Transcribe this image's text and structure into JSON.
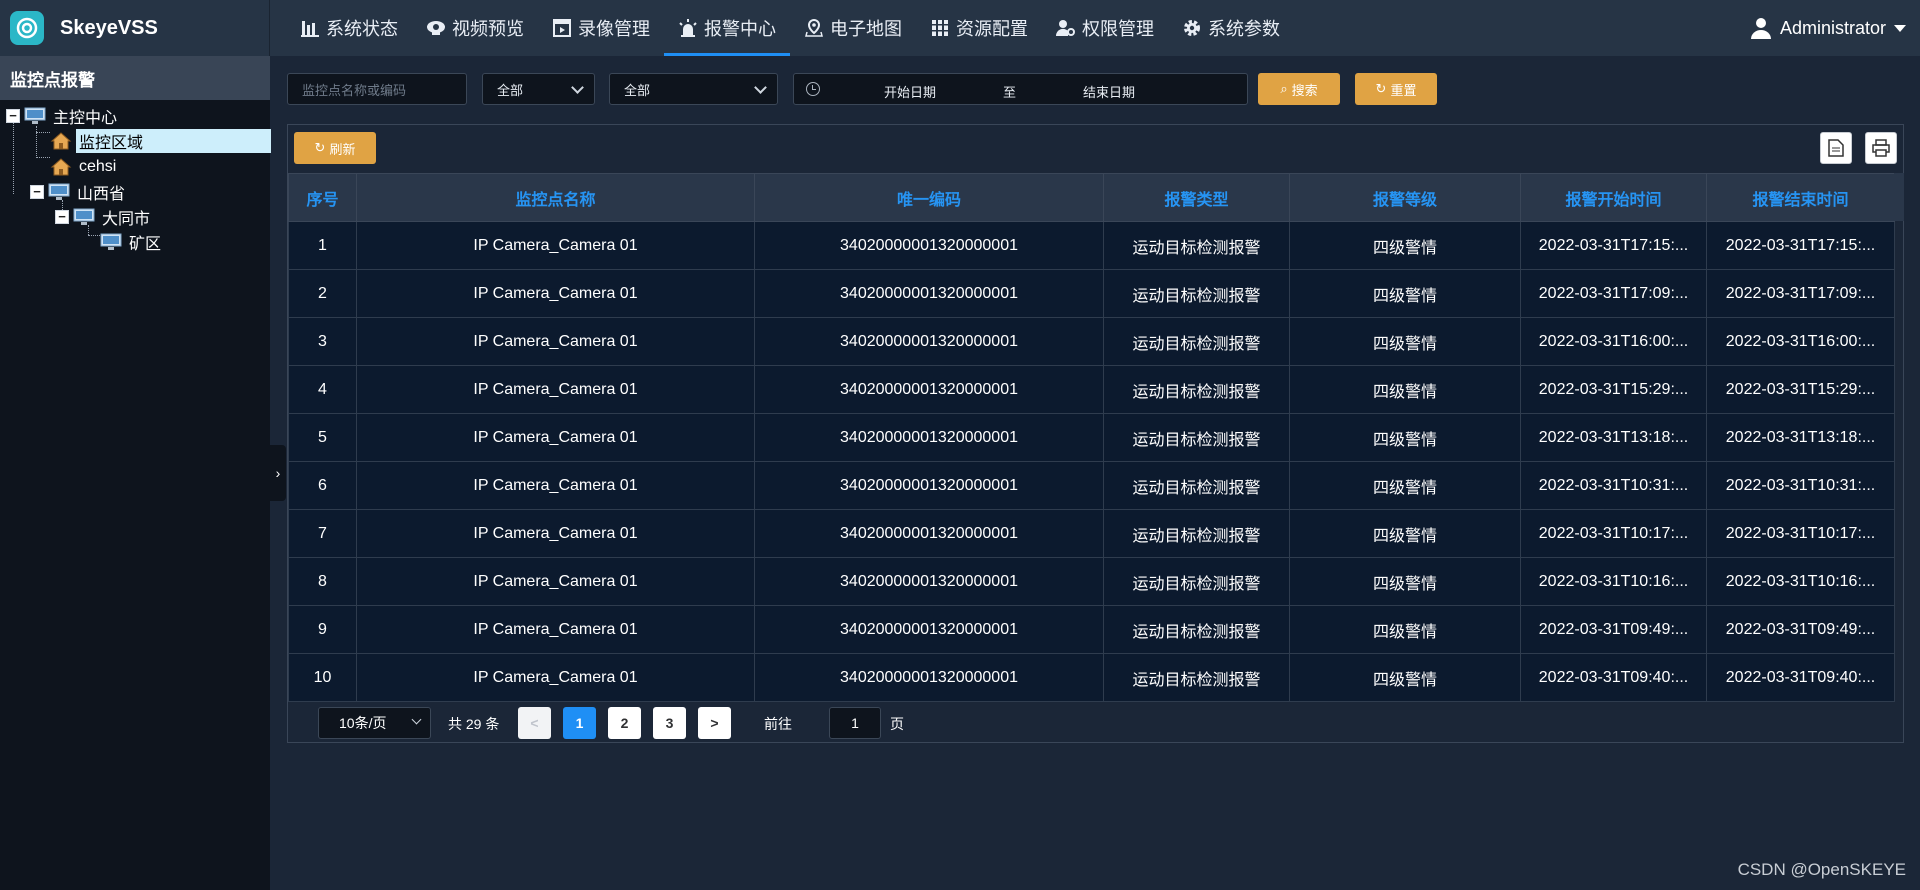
{
  "app": {
    "name": "SkeyeVSS"
  },
  "nav": [
    {
      "label": "系统状态",
      "icon": "bar-chart-icon"
    },
    {
      "label": "视频预览",
      "icon": "camera-icon"
    },
    {
      "label": "录像管理",
      "icon": "video-file-icon"
    },
    {
      "label": "报警中心",
      "icon": "alarm-light-icon",
      "active": true
    },
    {
      "label": "电子地图",
      "icon": "map-icon"
    },
    {
      "label": "资源配置",
      "icon": "resource-icon"
    },
    {
      "label": "权限管理",
      "icon": "user-gear-icon"
    },
    {
      "label": "系统参数",
      "icon": "gear-icon"
    }
  ],
  "user": {
    "name": "Administrator"
  },
  "sidebar": {
    "title": "监控点报警",
    "tree": [
      {
        "label": "主控中心",
        "icon": "monitor-icon",
        "toggle": "−"
      },
      {
        "label": "监控区域",
        "icon": "house-icon",
        "selected": true
      },
      {
        "label": "cehsi",
        "icon": "house-icon"
      },
      {
        "label": "山西省",
        "icon": "monitor-icon",
        "toggle": "−"
      },
      {
        "label": "大同市",
        "icon": "monitor-icon",
        "toggle": "−"
      },
      {
        "label": "矿区",
        "icon": "monitor-icon"
      }
    ]
  },
  "filters": {
    "name_placeholder": "监控点名称或编码",
    "select1": "全部",
    "select2": "全部",
    "start_date": "开始日期",
    "to_label": "至",
    "end_date": "结束日期",
    "search_label": "搜索",
    "reset_label": "重置"
  },
  "toolbar": {
    "refresh_label": "刷新"
  },
  "table": {
    "columns": [
      "序号",
      "监控点名称",
      "唯一编码",
      "报警类型",
      "报警等级",
      "报警开始时间",
      "报警结束时间"
    ],
    "rows": [
      [
        "1",
        "IP Camera_Camera 01",
        "34020000001320000001",
        "运动目标检测报警",
        "四级警情",
        "2022-03-31T17:15:...",
        "2022-03-31T17:15:..."
      ],
      [
        "2",
        "IP Camera_Camera 01",
        "34020000001320000001",
        "运动目标检测报警",
        "四级警情",
        "2022-03-31T17:09:...",
        "2022-03-31T17:09:..."
      ],
      [
        "3",
        "IP Camera_Camera 01",
        "34020000001320000001",
        "运动目标检测报警",
        "四级警情",
        "2022-03-31T16:00:...",
        "2022-03-31T16:00:..."
      ],
      [
        "4",
        "IP Camera_Camera 01",
        "34020000001320000001",
        "运动目标检测报警",
        "四级警情",
        "2022-03-31T15:29:...",
        "2022-03-31T15:29:..."
      ],
      [
        "5",
        "IP Camera_Camera 01",
        "34020000001320000001",
        "运动目标检测报警",
        "四级警情",
        "2022-03-31T13:18:...",
        "2022-03-31T13:18:..."
      ],
      [
        "6",
        "IP Camera_Camera 01",
        "34020000001320000001",
        "运动目标检测报警",
        "四级警情",
        "2022-03-31T10:31:...",
        "2022-03-31T10:31:..."
      ],
      [
        "7",
        "IP Camera_Camera 01",
        "34020000001320000001",
        "运动目标检测报警",
        "四级警情",
        "2022-03-31T10:17:...",
        "2022-03-31T10:17:..."
      ],
      [
        "8",
        "IP Camera_Camera 01",
        "34020000001320000001",
        "运动目标检测报警",
        "四级警情",
        "2022-03-31T10:16:...",
        "2022-03-31T10:16:..."
      ],
      [
        "9",
        "IP Camera_Camera 01",
        "34020000001320000001",
        "运动目标检测报警",
        "四级警情",
        "2022-03-31T09:49:...",
        "2022-03-31T09:49:..."
      ],
      [
        "10",
        "IP Camera_Camera 01",
        "34020000001320000001",
        "运动目标检测报警",
        "四级警情",
        "2022-03-31T09:40:...",
        "2022-03-31T09:40:..."
      ]
    ]
  },
  "pagination": {
    "page_size": "10条/页",
    "total": "共 29 条",
    "pages": [
      "1",
      "2",
      "3"
    ],
    "current": "1",
    "prev": "<",
    "next": ">",
    "goto_prefix": "前往",
    "goto_value": "1",
    "goto_suffix": "页"
  },
  "watermark": "CSDN @OpenSKEYE",
  "colors": {
    "accent": "#1f8ff5",
    "button": "#e0a344",
    "header_text": "#2694f3"
  }
}
